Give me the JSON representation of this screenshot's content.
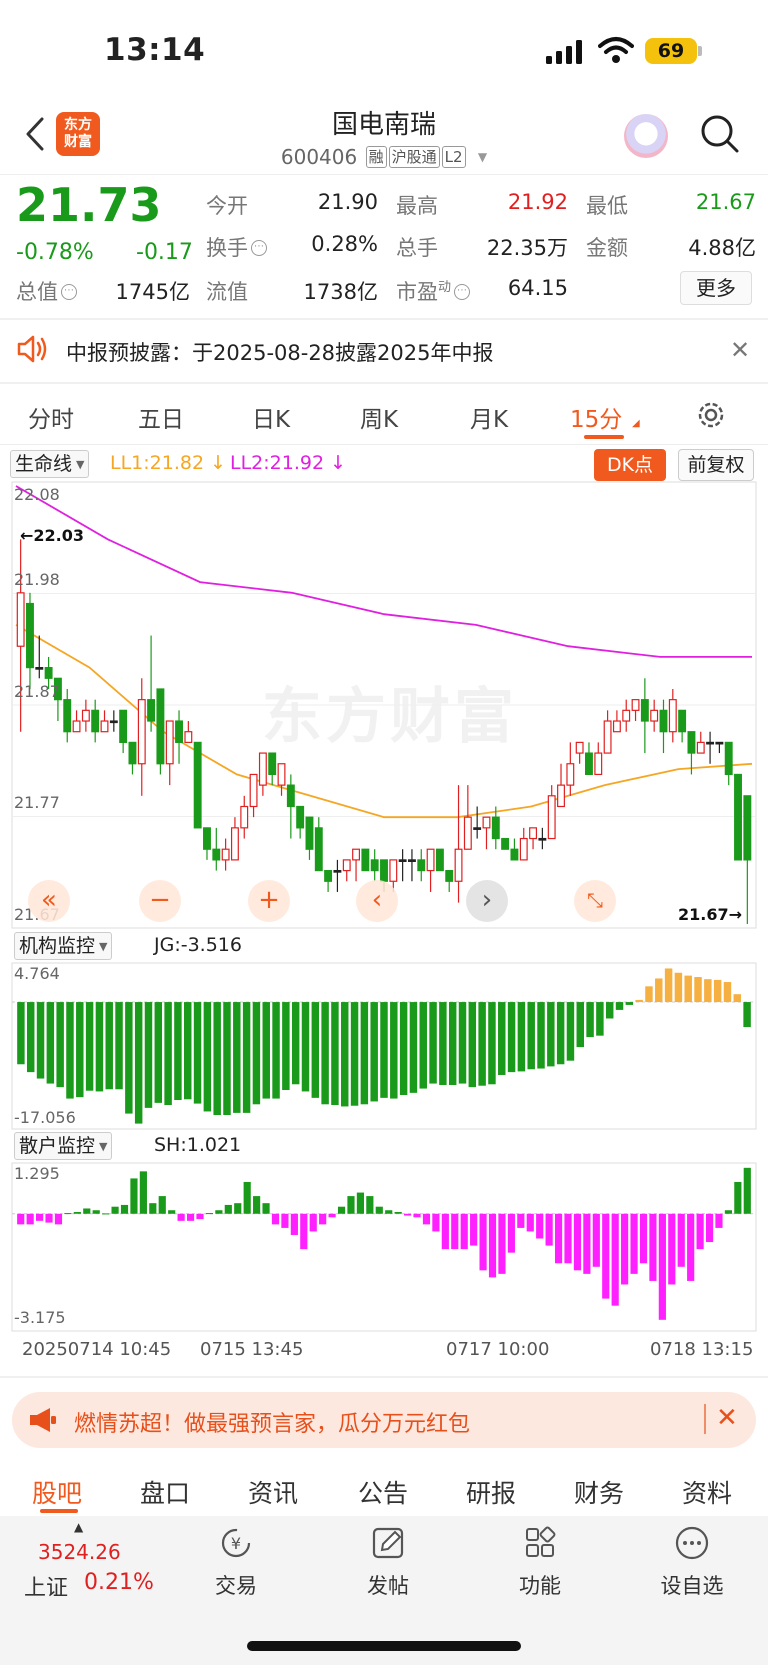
{
  "status_bar": {
    "time": "13:14",
    "battery": "69"
  },
  "header": {
    "logo": "东方\n财富",
    "stock_name": "国电南瑞",
    "stock_code": "600406",
    "tags": [
      "融",
      "沪股通",
      "L2"
    ]
  },
  "quote": {
    "price": "21.73",
    "change_pct": "-0.78%",
    "change": "-0.17",
    "total_value_label": "总值",
    "total_value": "1745亿",
    "fields": [
      {
        "label": "今开",
        "value": "21.90",
        "color": "#222222"
      },
      {
        "label": "最高",
        "value": "21.92",
        "color": "#e02020"
      },
      {
        "label": "最低",
        "value": "21.67",
        "color": "#1a9a1a"
      },
      {
        "label": "换手",
        "value": "0.28%",
        "color": "#222222"
      },
      {
        "label": "总手",
        "value": "22.35万",
        "color": "#222222"
      },
      {
        "label": "金额",
        "value": "4.88亿",
        "color": "#222222"
      },
      {
        "label": "流值",
        "value": "1738亿",
        "color": "#222222"
      },
      {
        "label": "市盈",
        "value": "64.15",
        "color": "#222222"
      }
    ],
    "pe_sup": "动",
    "more": "更多"
  },
  "notice": {
    "text": "中报预披露：于2025-08-28披露2025年中报"
  },
  "period_tabs": [
    "分时",
    "五日",
    "日K",
    "周K",
    "月K",
    "15分"
  ],
  "active_period": "15分",
  "chart": {
    "indicator": "生命线",
    "ll1": "LL1:21.82",
    "ll2": "LL2:21.92",
    "dk_button": "DK点",
    "adjust_button": "前复权",
    "y_labels": [
      "22.08",
      "21.98",
      "21.87",
      "21.77",
      "21.67"
    ],
    "high_marker": "22.03",
    "low_marker": "21.67",
    "watermark": "东方财富",
    "sub1_name": "机构监控",
    "sub1_value": "JG:-3.516",
    "sub1_max": "4.764",
    "sub1_min": "-17.056",
    "sub2_name": "散户监控",
    "sub2_value": "SH:1.021",
    "sub2_max": "1.295",
    "sub2_min": "-3.175",
    "time_labels": [
      "20250714 10:45",
      "0715 13:45",
      "0717 10:00",
      "0718 13:15"
    ],
    "colors": {
      "up": "#e02020",
      "down": "#1a9a1a",
      "ll1": "#f5a623",
      "ll2": "#e020e0",
      "orange": "#f5b041",
      "magenta": "#ff20ff"
    }
  },
  "chart_data": {
    "type": "candlestick",
    "ylim": [
      21.67,
      22.08
    ],
    "candles": [
      [
        21.93,
        21.98,
        21.85,
        22.03
      ],
      [
        21.97,
        21.91,
        21.89,
        21.98
      ],
      [
        21.91,
        21.91,
        21.9,
        21.94
      ],
      [
        21.91,
        21.9,
        21.89,
        21.92
      ],
      [
        21.9,
        21.88,
        21.86,
        21.9
      ],
      [
        21.88,
        21.85,
        21.84,
        21.89
      ],
      [
        21.85,
        21.86,
        21.85,
        21.87
      ],
      [
        21.86,
        21.87,
        21.85,
        21.88
      ],
      [
        21.87,
        21.85,
        21.84,
        21.88
      ],
      [
        21.85,
        21.86,
        21.85,
        21.87
      ],
      [
        21.86,
        21.86,
        21.85,
        21.87
      ],
      [
        21.87,
        21.84,
        21.83,
        21.87
      ],
      [
        21.84,
        21.82,
        21.81,
        21.84
      ],
      [
        21.82,
        21.88,
        21.79,
        21.9
      ],
      [
        21.88,
        21.86,
        21.85,
        21.94
      ],
      [
        21.89,
        21.82,
        21.81,
        21.89
      ],
      [
        21.82,
        21.86,
        21.8,
        21.86
      ],
      [
        21.86,
        21.84,
        21.82,
        21.87
      ],
      [
        21.84,
        21.85,
        21.84,
        21.86
      ],
      [
        21.84,
        21.76,
        21.76,
        21.84
      ],
      [
        21.76,
        21.74,
        21.73,
        21.76
      ],
      [
        21.74,
        21.73,
        21.72,
        21.76
      ],
      [
        21.73,
        21.74,
        21.72,
        21.75
      ],
      [
        21.73,
        21.76,
        21.73,
        21.77
      ],
      [
        21.76,
        21.78,
        21.75,
        21.79
      ],
      [
        21.78,
        21.81,
        21.77,
        21.81
      ],
      [
        21.8,
        21.83,
        21.79,
        21.83
      ],
      [
        21.83,
        21.81,
        21.8,
        21.83
      ],
      [
        21.8,
        21.82,
        21.79,
        21.82
      ],
      [
        21.8,
        21.78,
        21.75,
        21.81
      ],
      [
        21.78,
        21.76,
        21.75,
        21.78
      ],
      [
        21.77,
        21.74,
        21.73,
        21.77
      ],
      [
        21.76,
        21.72,
        21.72,
        21.77
      ],
      [
        21.72,
        21.71,
        21.7,
        21.72
      ],
      [
        21.72,
        21.72,
        21.7,
        21.73
      ],
      [
        21.72,
        21.73,
        21.71,
        21.73
      ],
      [
        21.73,
        21.74,
        21.71,
        21.74
      ],
      [
        21.74,
        21.72,
        21.72,
        21.74
      ],
      [
        21.73,
        21.72,
        21.71,
        21.74
      ],
      [
        21.73,
        21.71,
        21.7,
        21.73
      ],
      [
        21.71,
        21.73,
        21.7,
        21.73
      ],
      [
        21.73,
        21.73,
        21.71,
        21.74
      ],
      [
        21.73,
        21.73,
        21.71,
        21.74
      ],
      [
        21.73,
        21.72,
        21.71,
        21.74
      ],
      [
        21.72,
        21.74,
        21.7,
        21.74
      ],
      [
        21.74,
        21.72,
        21.72,
        21.74
      ],
      [
        21.72,
        21.71,
        21.7,
        21.72
      ],
      [
        21.71,
        21.74,
        21.69,
        21.8
      ],
      [
        21.74,
        21.77,
        21.74,
        21.8
      ],
      [
        21.76,
        21.76,
        21.75,
        21.78
      ],
      [
        21.76,
        21.77,
        21.74,
        21.77
      ],
      [
        21.77,
        21.75,
        21.74,
        21.78
      ],
      [
        21.75,
        21.74,
        21.74,
        21.75
      ],
      [
        21.74,
        21.73,
        21.73,
        21.75
      ],
      [
        21.73,
        21.75,
        21.73,
        21.76
      ],
      [
        21.75,
        21.76,
        21.74,
        21.76
      ],
      [
        21.75,
        21.75,
        21.74,
        21.76
      ],
      [
        21.75,
        21.79,
        21.75,
        21.8
      ],
      [
        21.78,
        21.8,
        21.78,
        21.82
      ],
      [
        21.8,
        21.82,
        21.79,
        21.84
      ],
      [
        21.83,
        21.84,
        21.82,
        21.84
      ],
      [
        21.83,
        21.81,
        21.81,
        21.84
      ],
      [
        21.81,
        21.83,
        21.81,
        21.84
      ],
      [
        21.83,
        21.86,
        21.83,
        21.87
      ],
      [
        21.85,
        21.86,
        21.85,
        21.87
      ],
      [
        21.86,
        21.87,
        21.85,
        21.88
      ],
      [
        21.87,
        21.88,
        21.86,
        21.88
      ],
      [
        21.88,
        21.86,
        21.83,
        21.9
      ],
      [
        21.86,
        21.87,
        21.85,
        21.88
      ],
      [
        21.87,
        21.85,
        21.83,
        21.88
      ],
      [
        21.85,
        21.88,
        21.84,
        21.89
      ],
      [
        21.87,
        21.85,
        21.84,
        21.87
      ],
      [
        21.85,
        21.83,
        21.81,
        21.85
      ],
      [
        21.83,
        21.84,
        21.83,
        21.85
      ],
      [
        21.84,
        21.84,
        21.82,
        21.85
      ],
      [
        21.84,
        21.84,
        21.83,
        21.84
      ],
      [
        21.84,
        21.81,
        21.8,
        21.84
      ],
      [
        21.81,
        21.73,
        21.77,
        21.81
      ],
      [
        21.79,
        21.73,
        21.67,
        21.79
      ]
    ],
    "ll1": [
      21.95,
      21.91,
      21.85,
      21.81,
      21.79,
      21.77,
      21.77,
      21.78,
      21.8,
      21.815,
      21.82
    ],
    "ll2": [
      22.08,
      22.03,
      21.99,
      21.98,
      21.96,
      21.95,
      21.93,
      21.92,
      21.92
    ],
    "jg": [
      -8.7,
      -9.8,
      -10.7,
      -11.4,
      -11.9,
      -13.5,
      -13.3,
      -12.4,
      -12.5,
      -12.2,
      -12.2,
      -15.6,
      -17.0,
      -14.8,
      -14.1,
      -14.4,
      -13.7,
      -13.6,
      -14.2,
      -15.3,
      -15.8,
      -15.8,
      -15.5,
      -15.5,
      -14.3,
      -13.5,
      -13.5,
      -12.3,
      -11.5,
      -12.5,
      -13.4,
      -14.3,
      -14.4,
      -14.6,
      -14.5,
      -14.3,
      -13.9,
      -13.4,
      -13.5,
      -13.0,
      -12.7,
      -12.1,
      -11.4,
      -11.6,
      -11.6,
      -11.4,
      -11.9,
      -11.7,
      -11.5,
      -10.2,
      -9.8,
      -9.7,
      -9.4,
      -9.3,
      -9.0,
      -8.7,
      -8.2,
      -6.3,
      -4.9,
      -4.7,
      -2.3,
      -1.1,
      -0.4,
      0.3,
      2.2,
      3.3,
      4.7,
      4.1,
      3.7,
      3.5,
      3.2,
      3.1,
      2.8,
      1.1,
      -3.5
    ],
    "sh": [
      -0.3,
      -0.3,
      -0.2,
      -0.25,
      -0.3,
      0.02,
      0.05,
      0.15,
      0.1,
      0.01,
      0.2,
      0.25,
      1.0,
      1.2,
      0.3,
      0.5,
      0.1,
      -0.2,
      -0.2,
      -0.15,
      0.02,
      0.1,
      0.25,
      0.3,
      0.9,
      0.5,
      0.3,
      -0.3,
      -0.4,
      -0.6,
      -1.0,
      -0.5,
      -0.3,
      -0.1,
      0.2,
      0.5,
      0.6,
      0.5,
      0.2,
      0.1,
      0.05,
      -0.05,
      -0.1,
      -0.3,
      -0.5,
      -1.0,
      -1.0,
      -1.0,
      -0.9,
      -1.6,
      -1.8,
      -1.7,
      -1.1,
      -0.4,
      -0.5,
      -0.7,
      -0.9,
      -1.4,
      -1.4,
      -1.6,
      -1.7,
      -1.5,
      -2.4,
      -2.6,
      -2.0,
      -1.7,
      -1.4,
      -1.9,
      -3.0,
      -2.0,
      -1.5,
      -1.9,
      -1.0,
      -0.8,
      -0.4,
      0.1,
      0.9,
      1.3
    ]
  },
  "promo": {
    "text": "燃情苏超！做最强预言家，瓜分万元红包"
  },
  "bottom_tabs": [
    "股吧",
    "盘口",
    "资讯",
    "公告",
    "研报",
    "财务",
    "资料"
  ],
  "bottom_nav": {
    "index_value": "3524.26",
    "index_name": "上证",
    "index_pct": "0.21%",
    "items": [
      {
        "label": "交易",
        "icon": "exchange-icon"
      },
      {
        "label": "发帖",
        "icon": "compose-icon"
      },
      {
        "label": "功能",
        "icon": "grid-icon"
      },
      {
        "label": "设自选",
        "icon": "more-icon"
      }
    ]
  }
}
